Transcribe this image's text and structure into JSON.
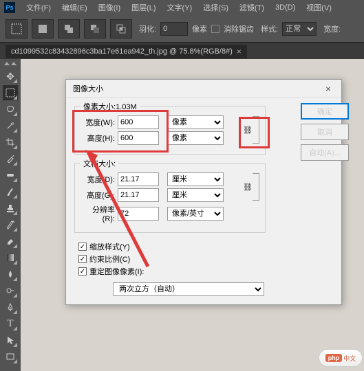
{
  "menubar": {
    "items": [
      "文件(F)",
      "编辑(E)",
      "图像(I)",
      "图层(L)",
      "文字(Y)",
      "选择(S)",
      "滤镜(T)",
      "3D(D)",
      "视图(V)"
    ]
  },
  "optionbar": {
    "feather_label": "羽化:",
    "feather_value": "0",
    "feather_unit": "像素",
    "antialias_label": "消除锯齿",
    "style_label": "样式:",
    "style_value": "正常",
    "width_label": "宽度:"
  },
  "tab": {
    "title": "cd1099532c83432896c3ba17e61ea942_th.jpg @ 75.8%(RGB/8#)"
  },
  "dialog": {
    "title": "图像大小",
    "pixel_section": {
      "legend_prefix": "像素大小:",
      "size": "1.03M",
      "width_label": "宽度(W):",
      "width_value": "600",
      "height_label": "高度(H):",
      "height_value": "600",
      "unit": "像素"
    },
    "doc_section": {
      "legend": "文档大小:",
      "width_label": "宽度(D):",
      "width_value": "21.17",
      "width_unit": "厘米",
      "height_label": "高度(G):",
      "height_value": "21.17",
      "height_unit": "厘米",
      "res_label": "分辨率(R):",
      "res_value": "72",
      "res_unit": "像素/英寸"
    },
    "checks": {
      "scale_styles": "缩放样式(Y)",
      "constrain": "约束比例(C)",
      "resample": "重定图像像素(I):"
    },
    "interp": "两次立方（自动）",
    "buttons": {
      "ok": "确定",
      "cancel": "取消",
      "auto": "自动(A)..."
    }
  },
  "badge": {
    "brand": "php",
    "text": "中文"
  }
}
